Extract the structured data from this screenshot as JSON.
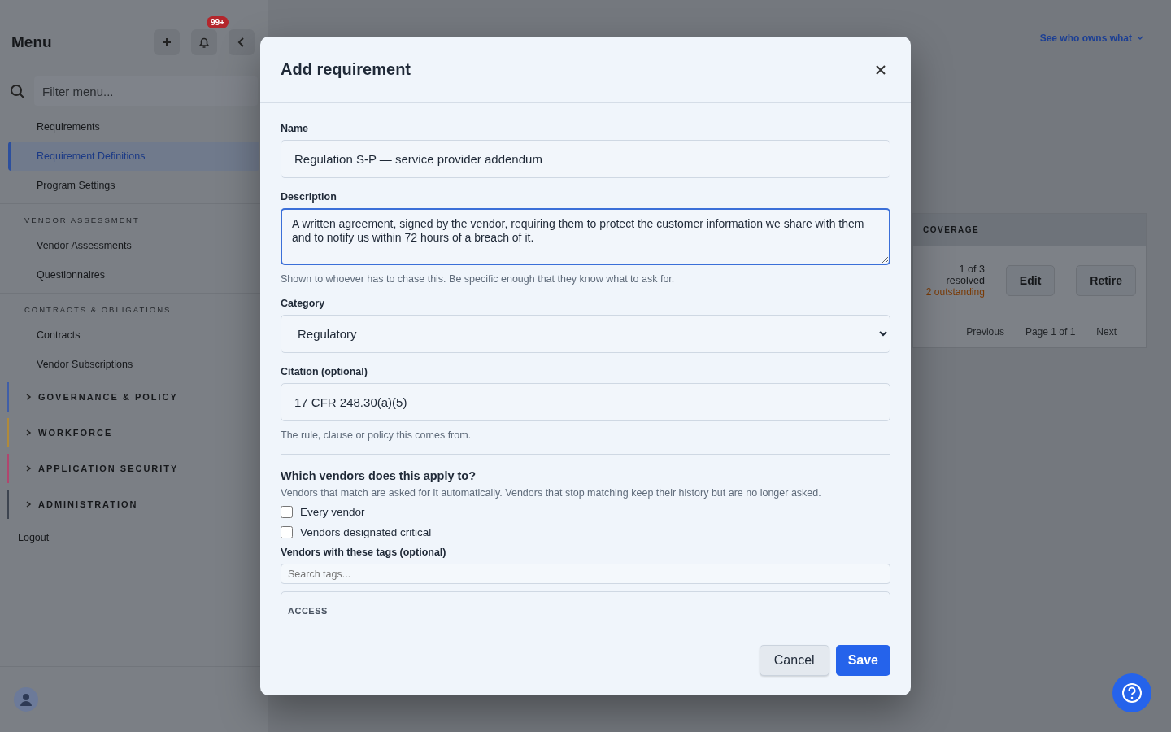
{
  "background": {
    "sidebar": {
      "title": "Menu",
      "notification_badge": "99+",
      "filter_placeholder": "Filter menu...",
      "items": [
        {
          "label": "Requirements",
          "selected": false
        },
        {
          "label": "Requirement Definitions",
          "selected": true
        },
        {
          "label": "Program Settings",
          "selected": false
        }
      ],
      "sections": [
        {
          "title": "VENDOR ASSESSMENT",
          "items": [
            {
              "label": "Vendor Assessments",
              "selected": false
            },
            {
              "label": "Questionnaires",
              "selected": false
            }
          ]
        },
        {
          "title": "CONTRACTS & OBLIGATIONS",
          "items": [
            {
              "label": "Contracts",
              "selected": false
            },
            {
              "label": "Vendor Subscriptions",
              "selected": false
            }
          ]
        }
      ],
      "groups": [
        {
          "label": "GOVERNANCE & POLICY",
          "color": "#3f5ea8",
          "expanded": false
        },
        {
          "label": "WORKFORCE",
          "color": "#b08a3a",
          "expanded": false
        },
        {
          "label": "APPLICATION SECURITY",
          "color": "#b0466e",
          "expanded": false
        },
        {
          "label": "ADMINISTRATION",
          "color": "#3d4450",
          "expanded": false
        }
      ],
      "logout": "Logout"
    },
    "main": {
      "owner_link": "See who owns what",
      "table": {
        "column": "COVERAGE",
        "rows": [
          {
            "coverage": "1 of 3 resolved",
            "outstanding": "2 outstanding",
            "actions": [
              "Edit",
              "Retire"
            ]
          }
        ],
        "pager": {
          "previous": "Previous",
          "page": "Page 1 of 1",
          "next": "Next"
        }
      }
    }
  },
  "dialog": {
    "title": "Add requirement",
    "name": {
      "label": "Name",
      "value": "Regulation S-P — service provider addendum"
    },
    "description": {
      "label": "Description",
      "value": "A written agreement, signed by the vendor, requiring them to protect the customer information we share with them and to notify us within 72 hours of a breach of it.",
      "hint": "Shown to whoever has to chase this. Be specific enough that they know what to ask for.",
      "focused": true
    },
    "category": {
      "label": "Category",
      "value": "Regulatory"
    },
    "citation": {
      "label": "Citation (optional)",
      "value": "17 CFR 248.30(a)(5)",
      "hint": "The rule, clause or policy this comes from."
    },
    "applies": {
      "heading": "Which vendors does this apply to?",
      "description": "Vendors that match are asked for it automatically. Vendors that stop matching keep their history but are no longer asked.",
      "options": [
        {
          "label": "Every vendor",
          "checked": false
        },
        {
          "label": "Vendors designated critical",
          "checked": false
        }
      ],
      "tags": {
        "label": "Vendors with these tags (optional)",
        "placeholder": "Search tags...",
        "group": "ACCESS"
      }
    },
    "buttons": {
      "cancel": "Cancel",
      "save": "Save"
    }
  }
}
